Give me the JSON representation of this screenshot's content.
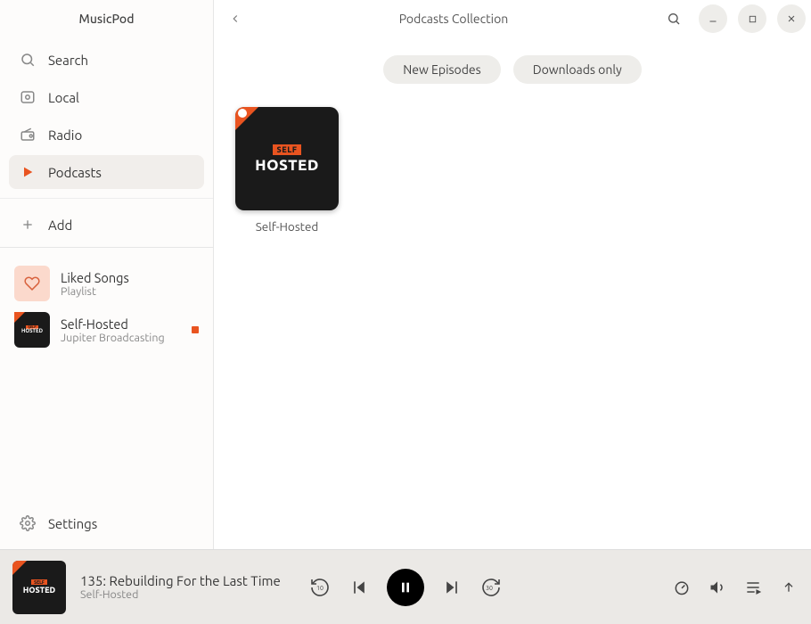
{
  "app": {
    "title": "MusicPod"
  },
  "sidebar": {
    "search_label": "Search",
    "local_label": "Local",
    "radio_label": "Radio",
    "podcasts_label": "Podcasts",
    "add_label": "Add",
    "settings_label": "Settings",
    "library": [
      {
        "title": "Liked Songs",
        "subtitle": "Playlist"
      },
      {
        "title": "Self-Hosted",
        "subtitle": "Jupiter Broadcasting"
      }
    ]
  },
  "header": {
    "title": "Podcasts Collection"
  },
  "filters": {
    "new_episodes": "New Episodes",
    "downloads_only": "Downloads only"
  },
  "podcasts": [
    {
      "title": "Self-Hosted",
      "cover_top": "SELF",
      "cover_bottom": "HOSTED"
    }
  ],
  "player": {
    "track_title": "135: Rebuilding For the Last Time",
    "track_subtitle": "Self-Hosted",
    "skip_back_seconds": "10",
    "skip_fwd_seconds": "30"
  }
}
